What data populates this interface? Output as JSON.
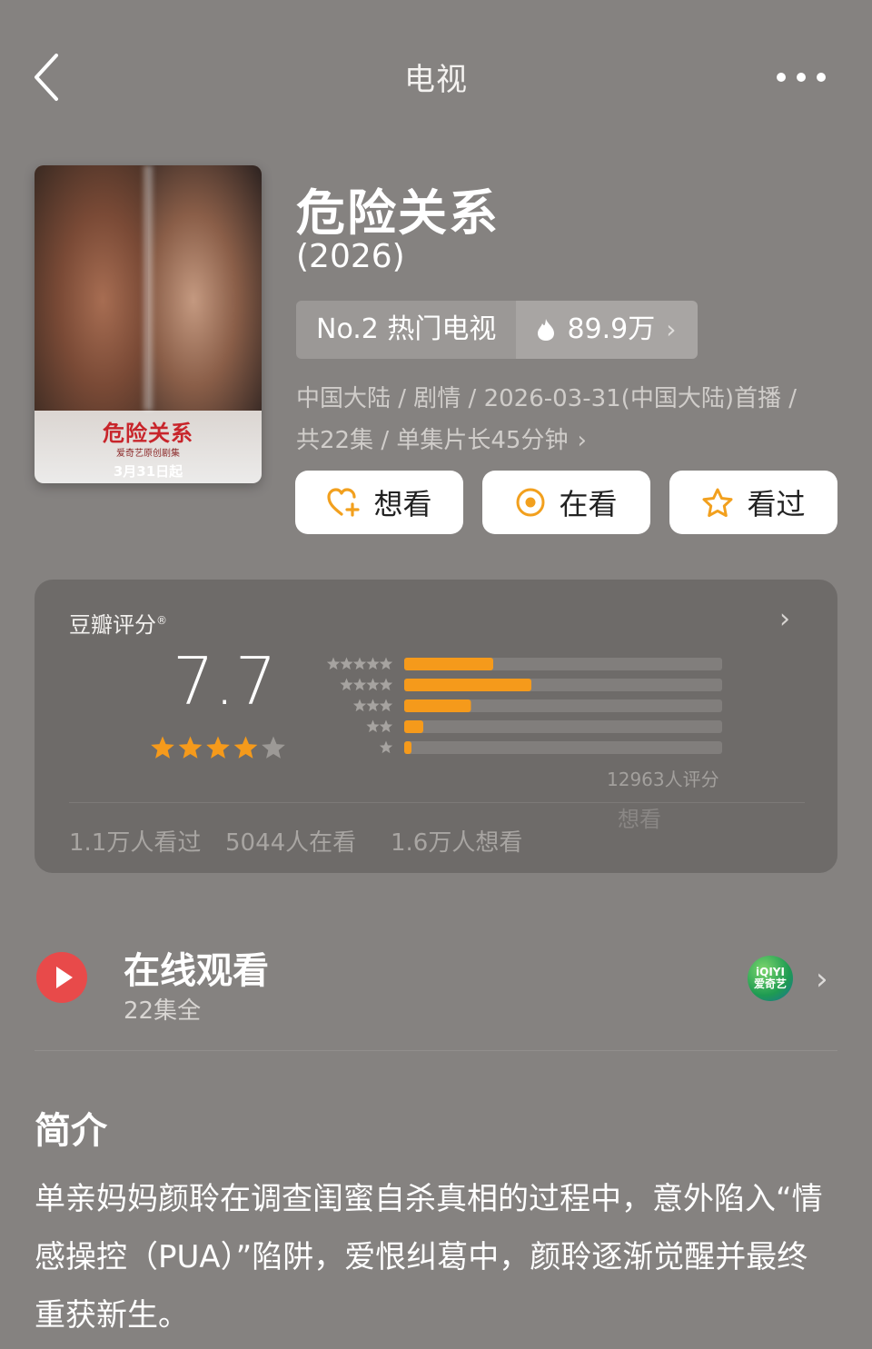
{
  "nav": {
    "title": "电视"
  },
  "poster": {
    "title": "危险关系",
    "subtitle": "爱奇艺原创剧集",
    "date": "3月31日起"
  },
  "show": {
    "title": "危险关系",
    "year": "(2026)"
  },
  "rank": {
    "label": "No.2 热门电视",
    "heat": "89.9万"
  },
  "meta": {
    "line1": "中国大陆 / 剧情 / 2026-03-31(中国大陆)首播 /",
    "line2": "共22集 / 单集片长45分钟"
  },
  "actions": {
    "want": "想看",
    "watching": "在看",
    "watched": "看过"
  },
  "rating": {
    "label": "豆瓣评分",
    "score": "7.7",
    "stars": 4,
    "star_color": "#f59a1b",
    "distribution": [
      0.28,
      0.4,
      0.21,
      0.06,
      0.02
    ],
    "count": "12963人评分",
    "stats": {
      "watched": "1.1万人看过",
      "watching": "5044人在看",
      "want": "1.6万人想看"
    },
    "ghost_want": "想看"
  },
  "online": {
    "title": "在线观看",
    "subtitle": "22集全",
    "provider_logo_text": [
      "iQIYI",
      "爱奇艺"
    ]
  },
  "intro": {
    "title": "简介",
    "text": "单亲妈妈颜聆在调查闺蜜自杀真相的过程中，意外陷入“情感操控（PUA）”陷阱，爱恨纠葛中，颜聆逐渐觉醒并最终重获新生。"
  }
}
